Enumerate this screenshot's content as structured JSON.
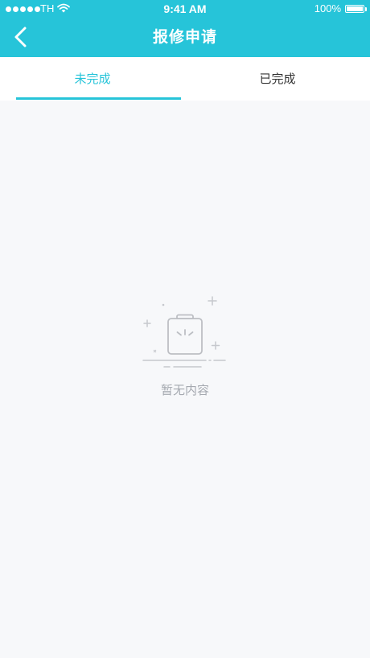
{
  "status_bar": {
    "carrier": "TH",
    "time": "9:41 AM",
    "battery": "100%"
  },
  "nav": {
    "title": "报修申请",
    "back_icon": "chevron-left-icon"
  },
  "tabs": [
    {
      "label": "未完成",
      "active": true
    },
    {
      "label": "已完成",
      "active": false
    }
  ],
  "empty_state": {
    "icon": "clipboard-icon",
    "text": "暂无内容"
  },
  "colors": {
    "primary": "#26c4d9",
    "background": "#f7f8fa",
    "empty_text": "#a5a9b0",
    "tab_text": "#333333"
  }
}
